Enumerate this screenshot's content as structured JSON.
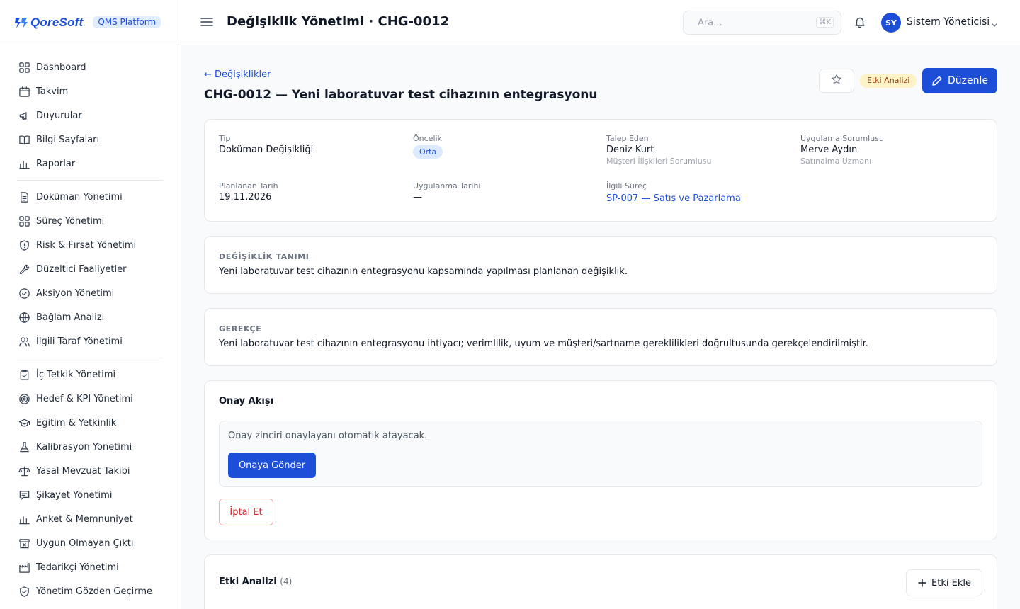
{
  "brand": {
    "name": "QoreSoft",
    "badge": "QMS Platform"
  },
  "sidebar": {
    "groups": [
      [
        {
          "label": "Dashboard",
          "icon": "grid-icon"
        },
        {
          "label": "Takvim",
          "icon": "calendar-icon"
        },
        {
          "label": "Duyurular",
          "icon": "megaphone-icon"
        },
        {
          "label": "Bilgi Sayfaları",
          "icon": "book-icon"
        },
        {
          "label": "Raporlar",
          "icon": "bar-chart-icon"
        }
      ],
      [
        {
          "label": "Doküman Yönetimi",
          "icon": "document-icon"
        },
        {
          "label": "Süreç Yönetimi",
          "icon": "grid-icon"
        },
        {
          "label": "Risk & Fırsat Yönetimi",
          "icon": "shield-icon"
        },
        {
          "label": "Düzeltici Faaliyetler",
          "icon": "wrench-icon"
        },
        {
          "label": "Aksiyon Yönetimi",
          "icon": "check-circle-icon"
        },
        {
          "label": "Bağlam Analizi",
          "icon": "globe-icon"
        },
        {
          "label": "İlgili Taraf Yönetimi",
          "icon": "users-icon"
        }
      ],
      [
        {
          "label": "İç Tetkik Yönetimi",
          "icon": "clipboard-check-icon"
        },
        {
          "label": "Hedef & KPI Yönetimi",
          "icon": "target-icon"
        },
        {
          "label": "Eğitim & Yetkinlik",
          "icon": "graduation-cap-icon"
        },
        {
          "label": "Kalibrasyon Yönetimi",
          "icon": "flask-icon"
        },
        {
          "label": "Yasal Mevzuat Takibi",
          "icon": "scale-icon"
        },
        {
          "label": "Şikayet Yönetimi",
          "icon": "message-icon"
        },
        {
          "label": "Anket & Memnuniyet",
          "icon": "bar-chart-icon"
        },
        {
          "label": "Uygun Olmayan Çıktı",
          "icon": "archive-x-icon"
        },
        {
          "label": "Tedarikçi Yönetimi",
          "icon": "factory-icon"
        },
        {
          "label": "Yönetim Gözden Geçirme",
          "icon": "shield-check-icon"
        }
      ]
    ]
  },
  "header": {
    "title": "Değişiklik Yönetimi · CHG-0012",
    "search_placeholder": "Ara...",
    "search_shortcut": "⌘K",
    "user_initials": "SY",
    "user_name": "Sistem Yöneticisi"
  },
  "detail": {
    "back_label": "← Değişiklikler",
    "title": "CHG-0012 — Yeni laboratuvar test cihazının entegrasyonu",
    "impact_badge": "Etki Analizi",
    "edit_label": "Düzenle"
  },
  "meta": {
    "type_label": "Tip",
    "type_value": "Doküman Değişikliği",
    "priority_label": "Öncelik",
    "priority_value": "Orta",
    "requester_label": "Talep Eden",
    "requester_name": "Deniz Kurt",
    "requester_role": "Müşteri İlişkileri Sorumlusu",
    "owner_label": "Uygulama Sorumlusu",
    "owner_name": "Merve Aydın",
    "owner_role": "Satınalma Uzmanı",
    "planned_label": "Planlanan Tarih",
    "planned_value": "19.11.2026",
    "applied_label": "Uygulanma Tarihi",
    "applied_value": "—",
    "process_label": "İlgili Süreç",
    "process_value": "SP-007 — Satış ve Pazarlama"
  },
  "description": {
    "label": "DEĞİŞİKLİK TANIMI",
    "text": "Yeni laboratuvar test cihazının entegrasyonu kapsamında yapılması planlanan değişiklik."
  },
  "justification": {
    "label": "GEREKÇE",
    "text": "Yeni laboratuvar test cihazının entegrasyonu ihtiyacı; verimlilik, uyum ve müşteri/şartname gereklilikleri doğrultusunda gerekçelendirilmiştir."
  },
  "approval": {
    "title": "Onay Akışı",
    "info": "Onay zinciri onaylayanı otomatik atayacak.",
    "submit_label": "Onaya Gönder",
    "cancel_label": "İptal Et"
  },
  "impact": {
    "title": "Etki Analizi",
    "count": "(4)",
    "add_label": "Etki Ekle"
  }
}
